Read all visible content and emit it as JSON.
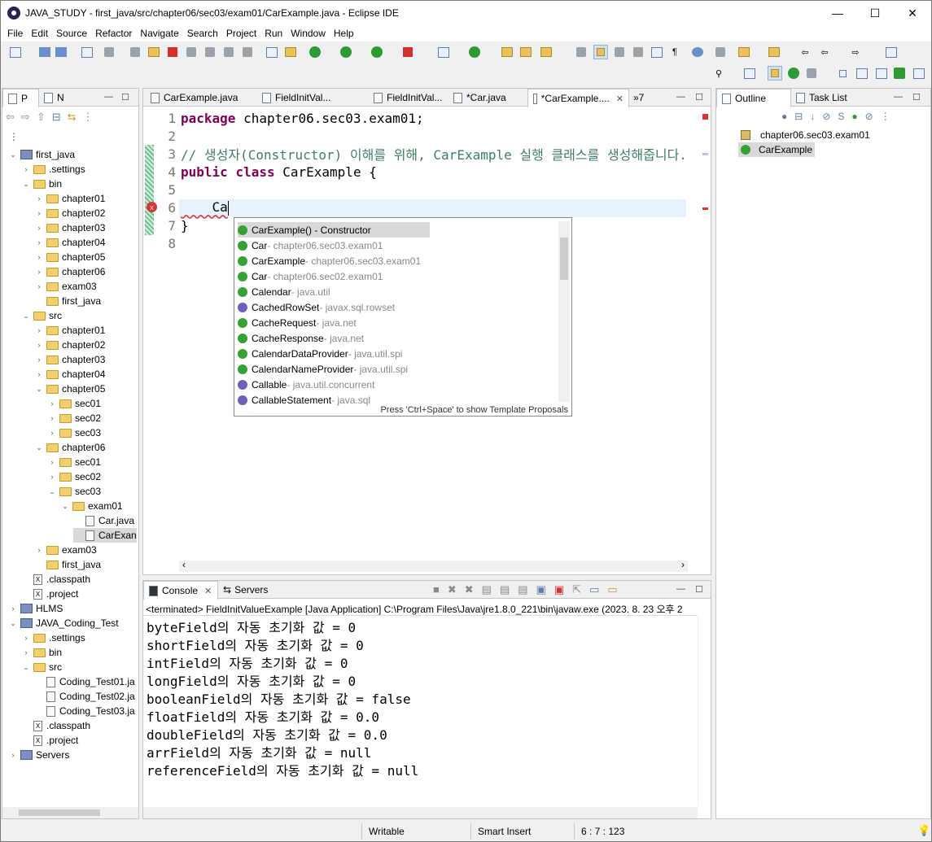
{
  "window": {
    "title": "JAVA_STUDY - first_java/src/chapter06/sec03/exam01/CarExample.java - Eclipse IDE",
    "minimize": "—",
    "maximize": "☐",
    "close": "✕"
  },
  "menu": [
    "File",
    "Edit",
    "Source",
    "Refactor",
    "Navigate",
    "Search",
    "Project",
    "Run",
    "Window",
    "Help"
  ],
  "explorer": {
    "tabs": [
      "P",
      "N"
    ],
    "tree": [
      {
        "indent": 0,
        "arrow": "v",
        "type": "project",
        "label": "first_java"
      },
      {
        "indent": 1,
        "arrow": ">",
        "type": "folder",
        "label": ".settings"
      },
      {
        "indent": 1,
        "arrow": "v",
        "type": "folder",
        "label": "bin"
      },
      {
        "indent": 2,
        "arrow": ">",
        "type": "folder",
        "label": "chapter01"
      },
      {
        "indent": 2,
        "arrow": ">",
        "type": "folder",
        "label": "chapter02"
      },
      {
        "indent": 2,
        "arrow": ">",
        "type": "folder",
        "label": "chapter03"
      },
      {
        "indent": 2,
        "arrow": ">",
        "type": "folder",
        "label": "chapter04"
      },
      {
        "indent": 2,
        "arrow": ">",
        "type": "folder",
        "label": "chapter05"
      },
      {
        "indent": 2,
        "arrow": ">",
        "type": "folder",
        "label": "chapter06"
      },
      {
        "indent": 2,
        "arrow": ">",
        "type": "folder",
        "label": "exam03"
      },
      {
        "indent": 2,
        "arrow": "",
        "type": "folder",
        "label": "first_java"
      },
      {
        "indent": 1,
        "arrow": "v",
        "type": "folder",
        "label": "src"
      },
      {
        "indent": 2,
        "arrow": ">",
        "type": "folder",
        "label": "chapter01"
      },
      {
        "indent": 2,
        "arrow": ">",
        "type": "folder",
        "label": "chapter02"
      },
      {
        "indent": 2,
        "arrow": ">",
        "type": "folder",
        "label": "chapter03"
      },
      {
        "indent": 2,
        "arrow": ">",
        "type": "folder",
        "label": "chapter04"
      },
      {
        "indent": 2,
        "arrow": "v",
        "type": "folder",
        "label": "chapter05"
      },
      {
        "indent": 3,
        "arrow": ">",
        "type": "folder",
        "label": "sec01"
      },
      {
        "indent": 3,
        "arrow": ">",
        "type": "folder",
        "label": "sec02"
      },
      {
        "indent": 3,
        "arrow": ">",
        "type": "folder",
        "label": "sec03"
      },
      {
        "indent": 2,
        "arrow": "v",
        "type": "folder",
        "label": "chapter06"
      },
      {
        "indent": 3,
        "arrow": ">",
        "type": "folder",
        "label": "sec01"
      },
      {
        "indent": 3,
        "arrow": ">",
        "type": "folder",
        "label": "sec02"
      },
      {
        "indent": 3,
        "arrow": "v",
        "type": "folder",
        "label": "sec03"
      },
      {
        "indent": 4,
        "arrow": "v",
        "type": "folder",
        "label": "exam01"
      },
      {
        "indent": 5,
        "arrow": "",
        "type": "java",
        "label": "Car.java"
      },
      {
        "indent": 5,
        "arrow": "",
        "type": "java",
        "label": "CarExan",
        "selected": true
      },
      {
        "indent": 2,
        "arrow": ">",
        "type": "folder",
        "label": "exam03"
      },
      {
        "indent": 2,
        "arrow": "",
        "type": "folder",
        "label": "first_java"
      },
      {
        "indent": 1,
        "arrow": "",
        "type": "xml",
        "label": ".classpath"
      },
      {
        "indent": 1,
        "arrow": "",
        "type": "xml",
        "label": ".project"
      },
      {
        "indent": 0,
        "arrow": ">",
        "type": "project",
        "label": "HLMS"
      },
      {
        "indent": 0,
        "arrow": "v",
        "type": "project",
        "label": "JAVA_Coding_Test"
      },
      {
        "indent": 1,
        "arrow": ">",
        "type": "folder",
        "label": ".settings"
      },
      {
        "indent": 1,
        "arrow": ">",
        "type": "folder",
        "label": "bin"
      },
      {
        "indent": 1,
        "arrow": "v",
        "type": "folder",
        "label": "src"
      },
      {
        "indent": 2,
        "arrow": "",
        "type": "java",
        "label": "Coding_Test01.ja"
      },
      {
        "indent": 2,
        "arrow": "",
        "type": "java",
        "label": "Coding_Test02.ja"
      },
      {
        "indent": 2,
        "arrow": "",
        "type": "java",
        "label": "Coding_Test03.ja"
      },
      {
        "indent": 1,
        "arrow": "",
        "type": "xml",
        "label": ".classpath"
      },
      {
        "indent": 1,
        "arrow": "",
        "type": "xml",
        "label": ".project"
      },
      {
        "indent": 0,
        "arrow": ">",
        "type": "project",
        "label": "Servers"
      }
    ]
  },
  "editor": {
    "tabs": [
      {
        "label": "CarExample.java",
        "active": false
      },
      {
        "label": "FieldInitVal...",
        "active": false
      },
      {
        "label": "FieldInitVal...",
        "active": false
      },
      {
        "label": "*Car.java",
        "active": false
      },
      {
        "label": "*CarExample....",
        "active": true
      }
    ],
    "overflow": "»7",
    "lines": [
      {
        "n": "1",
        "parts": [
          [
            "kw",
            "package"
          ],
          [
            "",
            " chapter06.sec03.exam01;"
          ]
        ]
      },
      {
        "n": "2",
        "parts": []
      },
      {
        "n": "3",
        "parts": [
          [
            "cm",
            "// 생성자(Constructor) 이해를 위해, CarExample 실행 클래스를 생성해줍니다."
          ]
        ]
      },
      {
        "n": "4",
        "parts": [
          [
            "kw",
            "public"
          ],
          [
            "",
            " "
          ],
          [
            "kw",
            "class"
          ],
          [
            "",
            " CarExample {"
          ]
        ]
      },
      {
        "n": "5",
        "parts": []
      },
      {
        "n": "6",
        "parts": [
          [
            "",
            "    Ca"
          ]
        ]
      },
      {
        "n": "7",
        "parts": [
          [
            "",
            "}"
          ]
        ]
      },
      {
        "n": "8",
        "parts": []
      }
    ]
  },
  "autocomplete": {
    "items": [
      {
        "name": "CarExample() - Constructor",
        "pkg": "",
        "icon": "class",
        "selected": true
      },
      {
        "name": "Car",
        "pkg": " - chapter06.sec03.exam01",
        "icon": "class"
      },
      {
        "name": "CarExample",
        "pkg": " - chapter06.sec03.exam01",
        "icon": "class"
      },
      {
        "name": "Car",
        "pkg": " - chapter06.sec02.exam01",
        "icon": "class"
      },
      {
        "name": "Calendar",
        "pkg": " - java.util",
        "icon": "class"
      },
      {
        "name": "CachedRowSet",
        "pkg": " - javax.sql.rowset",
        "icon": "iface"
      },
      {
        "name": "CacheRequest",
        "pkg": " - java.net",
        "icon": "class"
      },
      {
        "name": "CacheResponse",
        "pkg": " - java.net",
        "icon": "class"
      },
      {
        "name": "CalendarDataProvider",
        "pkg": " - java.util.spi",
        "icon": "class"
      },
      {
        "name": "CalendarNameProvider",
        "pkg": " - java.util.spi",
        "icon": "class"
      },
      {
        "name": "Callable",
        "pkg": " - java.util.concurrent",
        "icon": "iface"
      },
      {
        "name": "CallableStatement",
        "pkg": " - java.sql",
        "icon": "iface"
      }
    ],
    "hint": "Press 'Ctrl+Space' to show Template Proposals"
  },
  "outline": {
    "tabs": [
      "Outline",
      "Task List"
    ],
    "items": [
      {
        "label": "chapter06.sec03.exam01",
        "icon": "package"
      },
      {
        "label": "CarExample",
        "icon": "class",
        "selected": true
      }
    ]
  },
  "console": {
    "tabs": [
      "Console",
      "Servers"
    ],
    "header": "<terminated> FieldInitValueExample [Java Application] C:\\Program Files\\Java\\jre1.8.0_221\\bin\\javaw.exe  (2023. 8. 23 오후 2",
    "lines": [
      "byteField의 자동 초기화 값 = 0",
      "shortField의 자동 초기화 값 = 0",
      "intField의 자동 초기화 값 = 0",
      "longField의 자동 초기화 값 = 0",
      "booleanField의 자동 초기화 값 = false",
      "floatField의 자동 초기화 값 = 0.0",
      "doubleField의 자동 초기화 값 = 0.0",
      "arrField의 자동 초기화 값 = null",
      "referenceField의 자동 초기화 값 = null"
    ]
  },
  "status": {
    "mode": "Writable",
    "insert": "Smart Insert",
    "position": "6 : 7 : 123"
  },
  "colors": {
    "keyword": "#7f0055",
    "comment": "#3f7f5f",
    "current_line": "#e8f2fe",
    "selection": "#d9d9d9"
  }
}
